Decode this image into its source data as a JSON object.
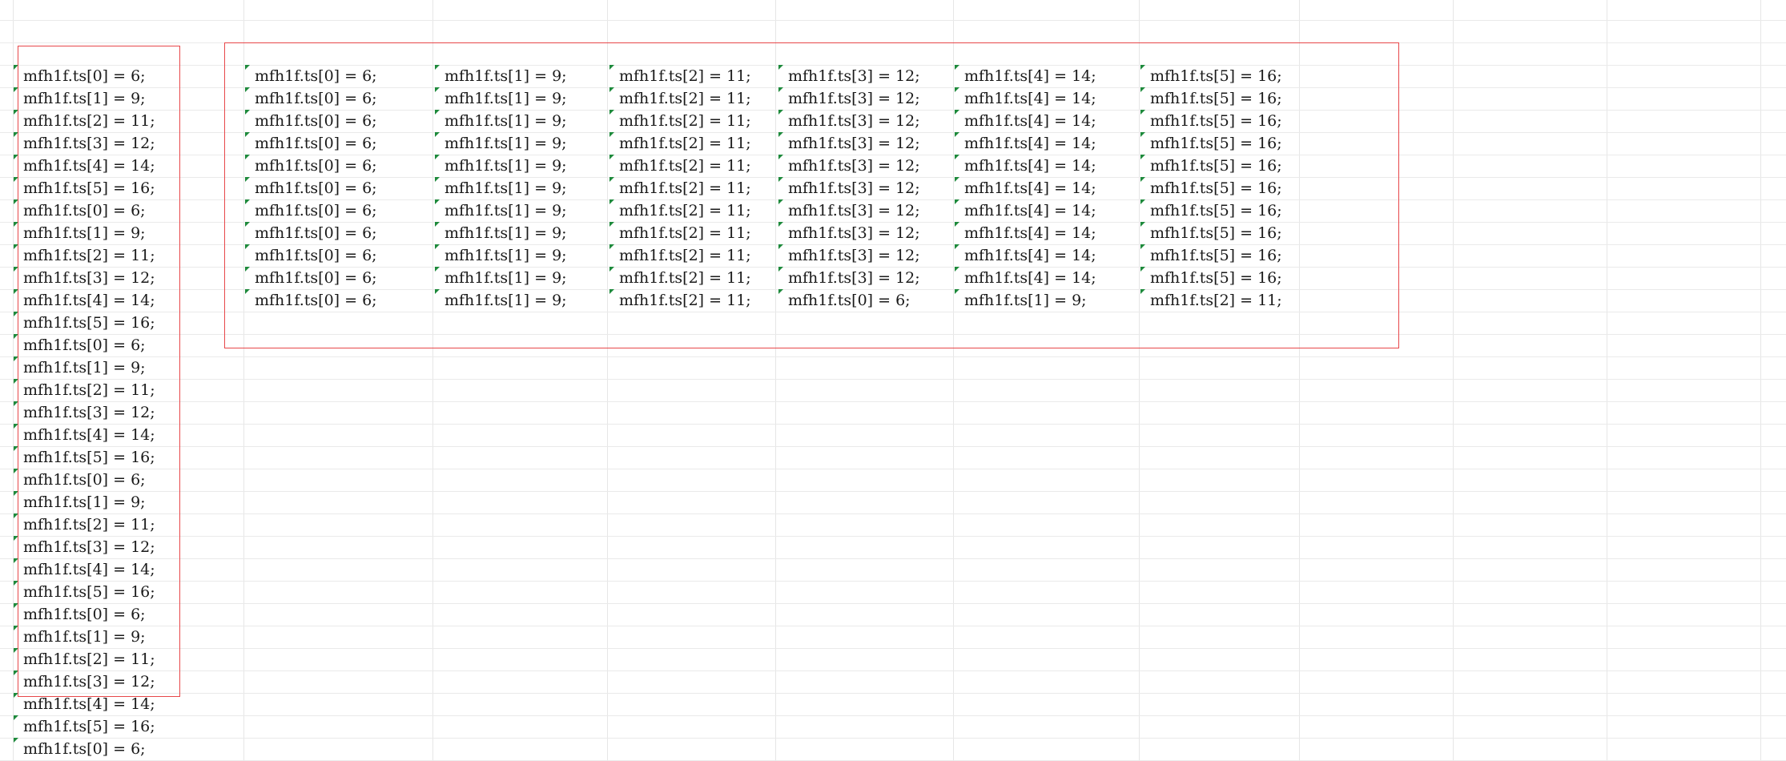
{
  "sheet": {
    "left_column": [
      "mfh1f.ts[0] = 6;",
      "mfh1f.ts[1] = 9;",
      "mfh1f.ts[2] = 11;",
      "mfh1f.ts[3] = 12;",
      "mfh1f.ts[4] = 14;",
      "mfh1f.ts[5] = 16;",
      "mfh1f.ts[0] = 6;",
      "mfh1f.ts[1] = 9;",
      "mfh1f.ts[2] = 11;",
      "mfh1f.ts[3] = 12;",
      "mfh1f.ts[4] = 14;",
      "mfh1f.ts[5] = 16;",
      "mfh1f.ts[0] = 6;",
      "mfh1f.ts[1] = 9;",
      "mfh1f.ts[2] = 11;",
      "mfh1f.ts[3] = 12;",
      "mfh1f.ts[4] = 14;",
      "mfh1f.ts[5] = 16;",
      "mfh1f.ts[0] = 6;",
      "mfh1f.ts[1] = 9;",
      "mfh1f.ts[2] = 11;",
      "mfh1f.ts[3] = 12;",
      "mfh1f.ts[4] = 14;",
      "mfh1f.ts[5] = 16;",
      "mfh1f.ts[0] = 6;",
      "mfh1f.ts[1] = 9;",
      "mfh1f.ts[2] = 11;",
      "mfh1f.ts[3] = 12;",
      "mfh1f.ts[4] = 14;",
      "mfh1f.ts[5] = 16;",
      "mfh1f.ts[0] = 6;"
    ],
    "grid_rows": [
      [
        "mfh1f.ts[0] = 6;",
        "mfh1f.ts[1] = 9;",
        "mfh1f.ts[2] = 11;",
        "mfh1f.ts[3] = 12;",
        "mfh1f.ts[4] = 14;",
        "mfh1f.ts[5] = 16;"
      ],
      [
        "mfh1f.ts[0] = 6;",
        "mfh1f.ts[1] = 9;",
        "mfh1f.ts[2] = 11;",
        "mfh1f.ts[3] = 12;",
        "mfh1f.ts[4] = 14;",
        "mfh1f.ts[5] = 16;"
      ],
      [
        "mfh1f.ts[0] = 6;",
        "mfh1f.ts[1] = 9;",
        "mfh1f.ts[2] = 11;",
        "mfh1f.ts[3] = 12;",
        "mfh1f.ts[4] = 14;",
        "mfh1f.ts[5] = 16;"
      ],
      [
        "mfh1f.ts[0] = 6;",
        "mfh1f.ts[1] = 9;",
        "mfh1f.ts[2] = 11;",
        "mfh1f.ts[3] = 12;",
        "mfh1f.ts[4] = 14;",
        "mfh1f.ts[5] = 16;"
      ],
      [
        "mfh1f.ts[0] = 6;",
        "mfh1f.ts[1] = 9;",
        "mfh1f.ts[2] = 11;",
        "mfh1f.ts[3] = 12;",
        "mfh1f.ts[4] = 14;",
        "mfh1f.ts[5] = 16;"
      ],
      [
        "mfh1f.ts[0] = 6;",
        "mfh1f.ts[1] = 9;",
        "mfh1f.ts[2] = 11;",
        "mfh1f.ts[3] = 12;",
        "mfh1f.ts[4] = 14;",
        "mfh1f.ts[5] = 16;"
      ],
      [
        "mfh1f.ts[0] = 6;",
        "mfh1f.ts[1] = 9;",
        "mfh1f.ts[2] = 11;",
        "mfh1f.ts[3] = 12;",
        "mfh1f.ts[4] = 14;",
        "mfh1f.ts[5] = 16;"
      ],
      [
        "mfh1f.ts[0] = 6;",
        "mfh1f.ts[1] = 9;",
        "mfh1f.ts[2] = 11;",
        "mfh1f.ts[3] = 12;",
        "mfh1f.ts[4] = 14;",
        "mfh1f.ts[5] = 16;"
      ],
      [
        "mfh1f.ts[0] = 6;",
        "mfh1f.ts[1] = 9;",
        "mfh1f.ts[2] = 11;",
        "mfh1f.ts[3] = 12;",
        "mfh1f.ts[4] = 14;",
        "mfh1f.ts[5] = 16;"
      ],
      [
        "mfh1f.ts[0] = 6;",
        "mfh1f.ts[1] = 9;",
        "mfh1f.ts[2] = 11;",
        "mfh1f.ts[3] = 12;",
        "mfh1f.ts[4] = 14;",
        "mfh1f.ts[5] = 16;"
      ],
      [
        "mfh1f.ts[0] = 6;",
        "mfh1f.ts[1] = 9;",
        "mfh1f.ts[2] = 11;",
        "mfh1f.ts[0] = 6;",
        "mfh1f.ts[1] = 9;",
        "mfh1f.ts[2] = 11;"
      ]
    ],
    "colors": {
      "gridline": "#e6e6e6",
      "selection_border": "#e8474a",
      "comment_marker": "#1e8a3c",
      "text": "#1a1a1a",
      "background": "#ffffff"
    }
  }
}
